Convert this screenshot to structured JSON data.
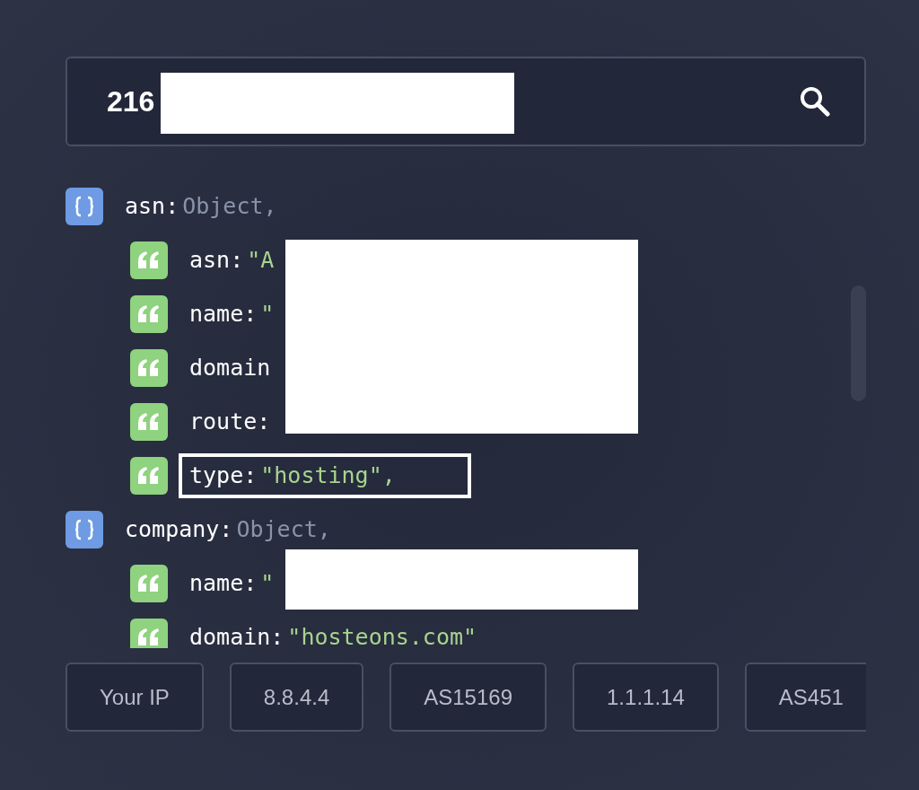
{
  "search": {
    "value": "216"
  },
  "tree": [
    {
      "kind": "object",
      "key": "asn:",
      "value": "Object,",
      "selected": false,
      "children": [
        {
          "kind": "string",
          "key": "asn:",
          "value": "\"A",
          "selected": false
        },
        {
          "kind": "string",
          "key": "name:",
          "value": "\"",
          "selected": false
        },
        {
          "kind": "string",
          "key": "domain",
          "selected": false
        },
        {
          "kind": "string",
          "key": "route:",
          "selected": false
        },
        {
          "kind": "string",
          "key": "type:",
          "value": "\"hosting\",",
          "selected": true
        }
      ]
    },
    {
      "kind": "object",
      "key": "company:",
      "value": "Object,",
      "selected": false,
      "children": [
        {
          "kind": "string",
          "key": "name:",
          "value": "\"",
          "selected": false
        },
        {
          "kind": "string",
          "key": "domain:",
          "value": "\"hosteons.com\"",
          "selected": false
        }
      ]
    }
  ],
  "quick_buttons": [
    "Your IP",
    "8.8.4.4",
    "AS15169",
    "1.1.1.14",
    "AS451"
  ]
}
